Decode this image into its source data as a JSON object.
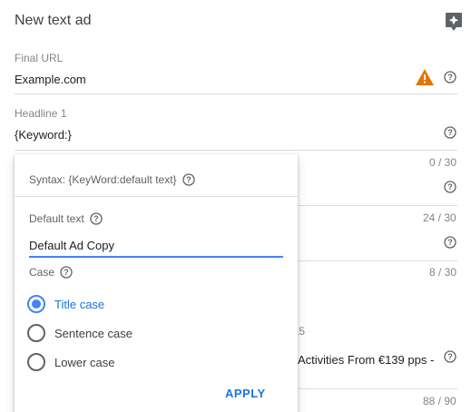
{
  "header": {
    "title": "New text ad",
    "ai_icon": "sparkle-icon"
  },
  "final_url": {
    "label": "Final URL",
    "value": "Example.com",
    "warning_icon": "warning-icon",
    "warning_color": "#e37400",
    "help_icon": "help-icon"
  },
  "headline1": {
    "label": "Headline 1",
    "value": "{Keyword:}",
    "help_icon": "help-icon"
  },
  "background_fields": {
    "counter_1": "0 / 30",
    "counter_2": "24 / 30",
    "counter_3": "8 / 30",
    "counter_4": "/ 15",
    "description_text": "Activities From €139 pps -",
    "counter_5": "88 / 90"
  },
  "popup": {
    "syntax_text": "Syntax: {KeyWord:default text}",
    "default_text_label": "Default text",
    "default_text_value": "Default Ad Copy",
    "case_label": "Case",
    "case_options": [
      {
        "label": "Title case",
        "selected": true
      },
      {
        "label": "Sentence case",
        "selected": false
      },
      {
        "label": "Lower case",
        "selected": false
      }
    ],
    "apply_label": "APPLY"
  },
  "colors": {
    "accent": "#1a73e8",
    "radio_accent": "#4285f4",
    "divider": "#dadce0"
  }
}
